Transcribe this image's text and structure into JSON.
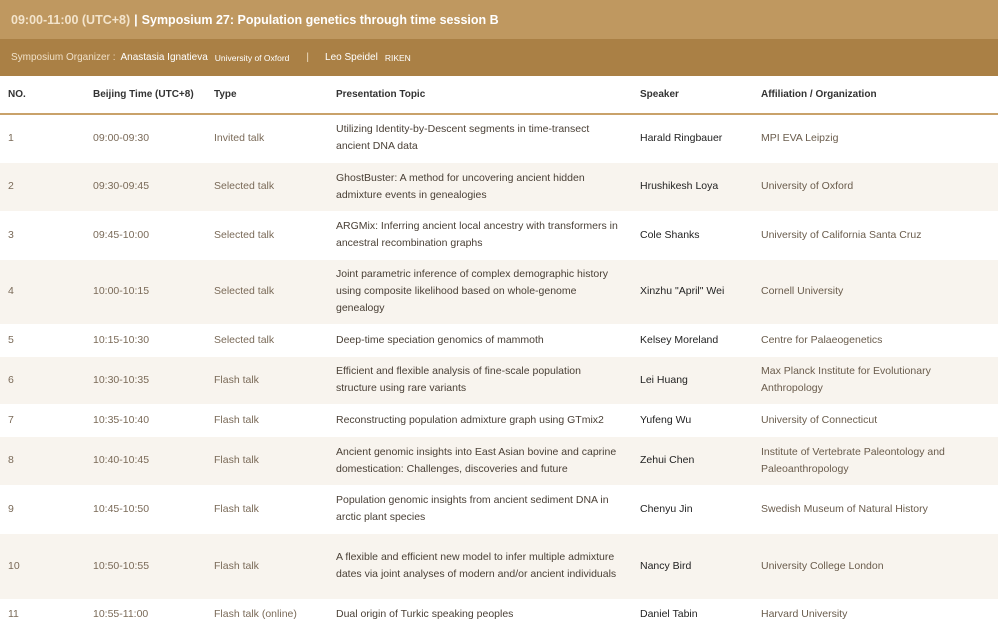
{
  "header": {
    "time": "09:00-11:00 (UTC+8)",
    "separator": "|",
    "title": "Symposium 27: Population genetics through time session B"
  },
  "organizers": {
    "label": "Symposium Organizer :",
    "divider": "|",
    "people": [
      {
        "name": "Anastasia Ignatieva",
        "affiliation": "University of Oxford"
      },
      {
        "name": "Leo Speidel",
        "affiliation": "RIKEN"
      }
    ]
  },
  "table": {
    "columns": [
      "NO.",
      "Beijing Time (UTC+8)",
      "Type",
      "Presentation Topic",
      "Speaker",
      "Affiliation / Organization"
    ],
    "rows": [
      {
        "no": "1",
        "time": "09:00-09:30",
        "type": "Invited talk",
        "topic": "Utilizing Identity-by-Descent segments in time-transect ancient DNA data",
        "speaker": "Harald Ringbauer",
        "affiliation": "MPI EVA Leipzig"
      },
      {
        "no": "2",
        "time": "09:30-09:45",
        "type": "Selected talk",
        "topic": "GhostBuster: A method for uncovering ancient hidden admixture events in genealogies",
        "speaker": "Hrushikesh Loya",
        "affiliation": "University of Oxford"
      },
      {
        "no": "3",
        "time": "09:45-10:00",
        "type": "Selected talk",
        "topic": "ARGMix: Inferring ancient local ancestry with transformers in ancestral recombination graphs",
        "speaker": "Cole Shanks",
        "affiliation": "University of California Santa Cruz"
      },
      {
        "no": "4",
        "time": "10:00-10:15",
        "type": "Selected talk",
        "topic": "Joint parametric inference of complex demographic history using composite likelihood based on whole-genome genealogy",
        "speaker": "Xinzhu \"April\" Wei",
        "affiliation": "Cornell University"
      },
      {
        "no": "5",
        "time": "10:15-10:30",
        "type": "Selected talk",
        "topic": "Deep-time speciation genomics of mammoth",
        "speaker": "Kelsey Moreland",
        "affiliation": "Centre for Palaeogenetics"
      },
      {
        "no": "6",
        "time": "10:30-10:35",
        "type": "Flash talk",
        "topic": "Efficient and flexible analysis of fine-scale population structure using rare variants",
        "speaker": "Lei Huang",
        "affiliation": "Max Planck Institute for Evolutionary Anthropology"
      },
      {
        "no": "7",
        "time": "10:35-10:40",
        "type": "Flash talk",
        "topic": "Reconstructing population admixture graph using GTmix2",
        "speaker": "Yufeng Wu",
        "affiliation": "University of Connecticut"
      },
      {
        "no": "8",
        "time": "10:40-10:45",
        "type": "Flash talk",
        "topic": "Ancient genomic insights into East Asian bovine and caprine domestication: Challenges, discoveries and future",
        "speaker": "Zehui Chen",
        "affiliation": "Institute of Vertebrate Paleontology and Paleoanthropology"
      },
      {
        "no": "9",
        "time": "10:45-10:50",
        "type": "Flash talk",
        "topic": "Population genomic insights from ancient sediment DNA in arctic plant species",
        "speaker": "Chenyu Jin",
        "affiliation": "Swedish Museum of Natural History"
      },
      {
        "no": "10",
        "time": "10:50-10:55",
        "type": "Flash talk",
        "topic": "A flexible and efficient new model to infer multiple admixture dates via joint analyses of modern and/or ancient individuals",
        "speaker": "Nancy Bird",
        "affiliation": "University College London"
      },
      {
        "no": "11",
        "time": "10:55-11:00",
        "type": "Flash talk (online)",
        "topic": "Dual origin of Turkic speaking peoples",
        "speaker": "Daniel Tabin",
        "affiliation": "Harvard University"
      }
    ]
  }
}
